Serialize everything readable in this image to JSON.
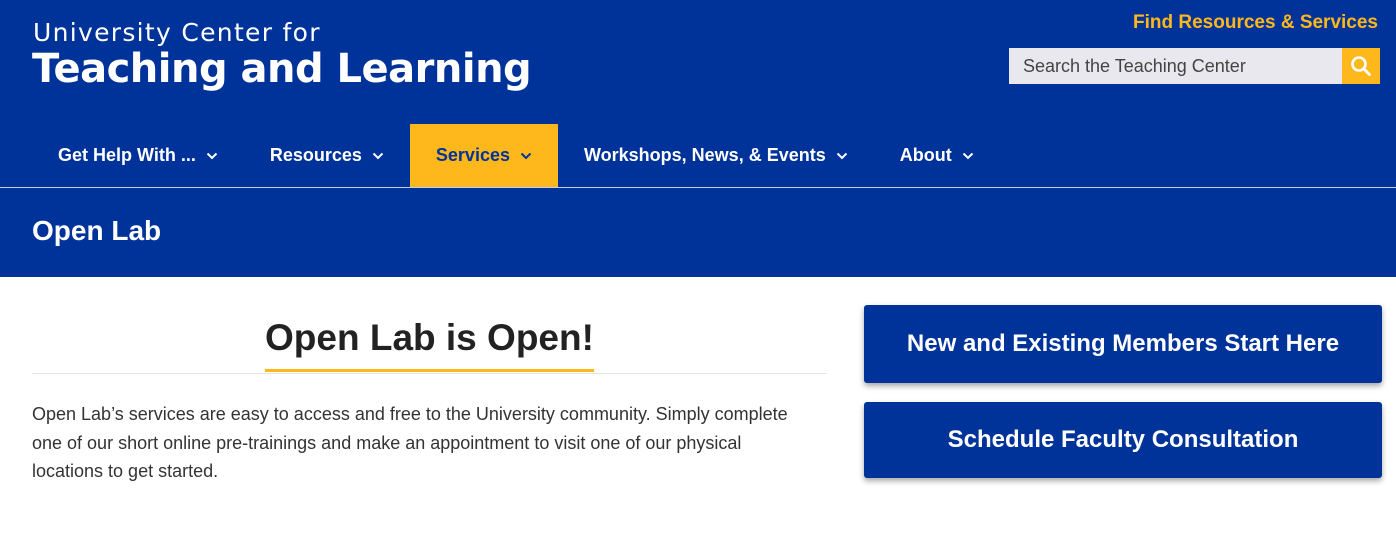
{
  "header": {
    "brand_top": "University Center for",
    "brand_main": "Teaching and Learning",
    "find_link": "Find Resources & Services",
    "search": {
      "placeholder": "Search the Teaching Center",
      "button_icon": "search-icon"
    }
  },
  "nav": {
    "items": [
      {
        "label": "Get Help With ...",
        "icon": "chevron-down-icon",
        "active": false
      },
      {
        "label": "Resources",
        "icon": "chevron-down-icon",
        "active": false
      },
      {
        "label": "Services",
        "icon": "chevron-down-icon",
        "active": true
      },
      {
        "label": "Workshops, News, & Events",
        "icon": "chevron-down-icon",
        "active": false
      },
      {
        "label": "About",
        "icon": "chevron-down-icon",
        "active": false
      }
    ]
  },
  "page": {
    "title": "Open Lab"
  },
  "main": {
    "heading": "Open Lab is Open!",
    "intro": "Open Lab’s services are easy to access and free to the University community. Simply complete one of our short online pre-trainings and make an appointment to visit one of our physical locations to get started."
  },
  "sidebar": {
    "buttons": [
      {
        "label": "New and Existing Members Start Here"
      },
      {
        "label": "Schedule Faculty Consultation"
      }
    ]
  },
  "colors": {
    "brand_blue": "#003399",
    "accent_gold": "#ffb81c"
  }
}
